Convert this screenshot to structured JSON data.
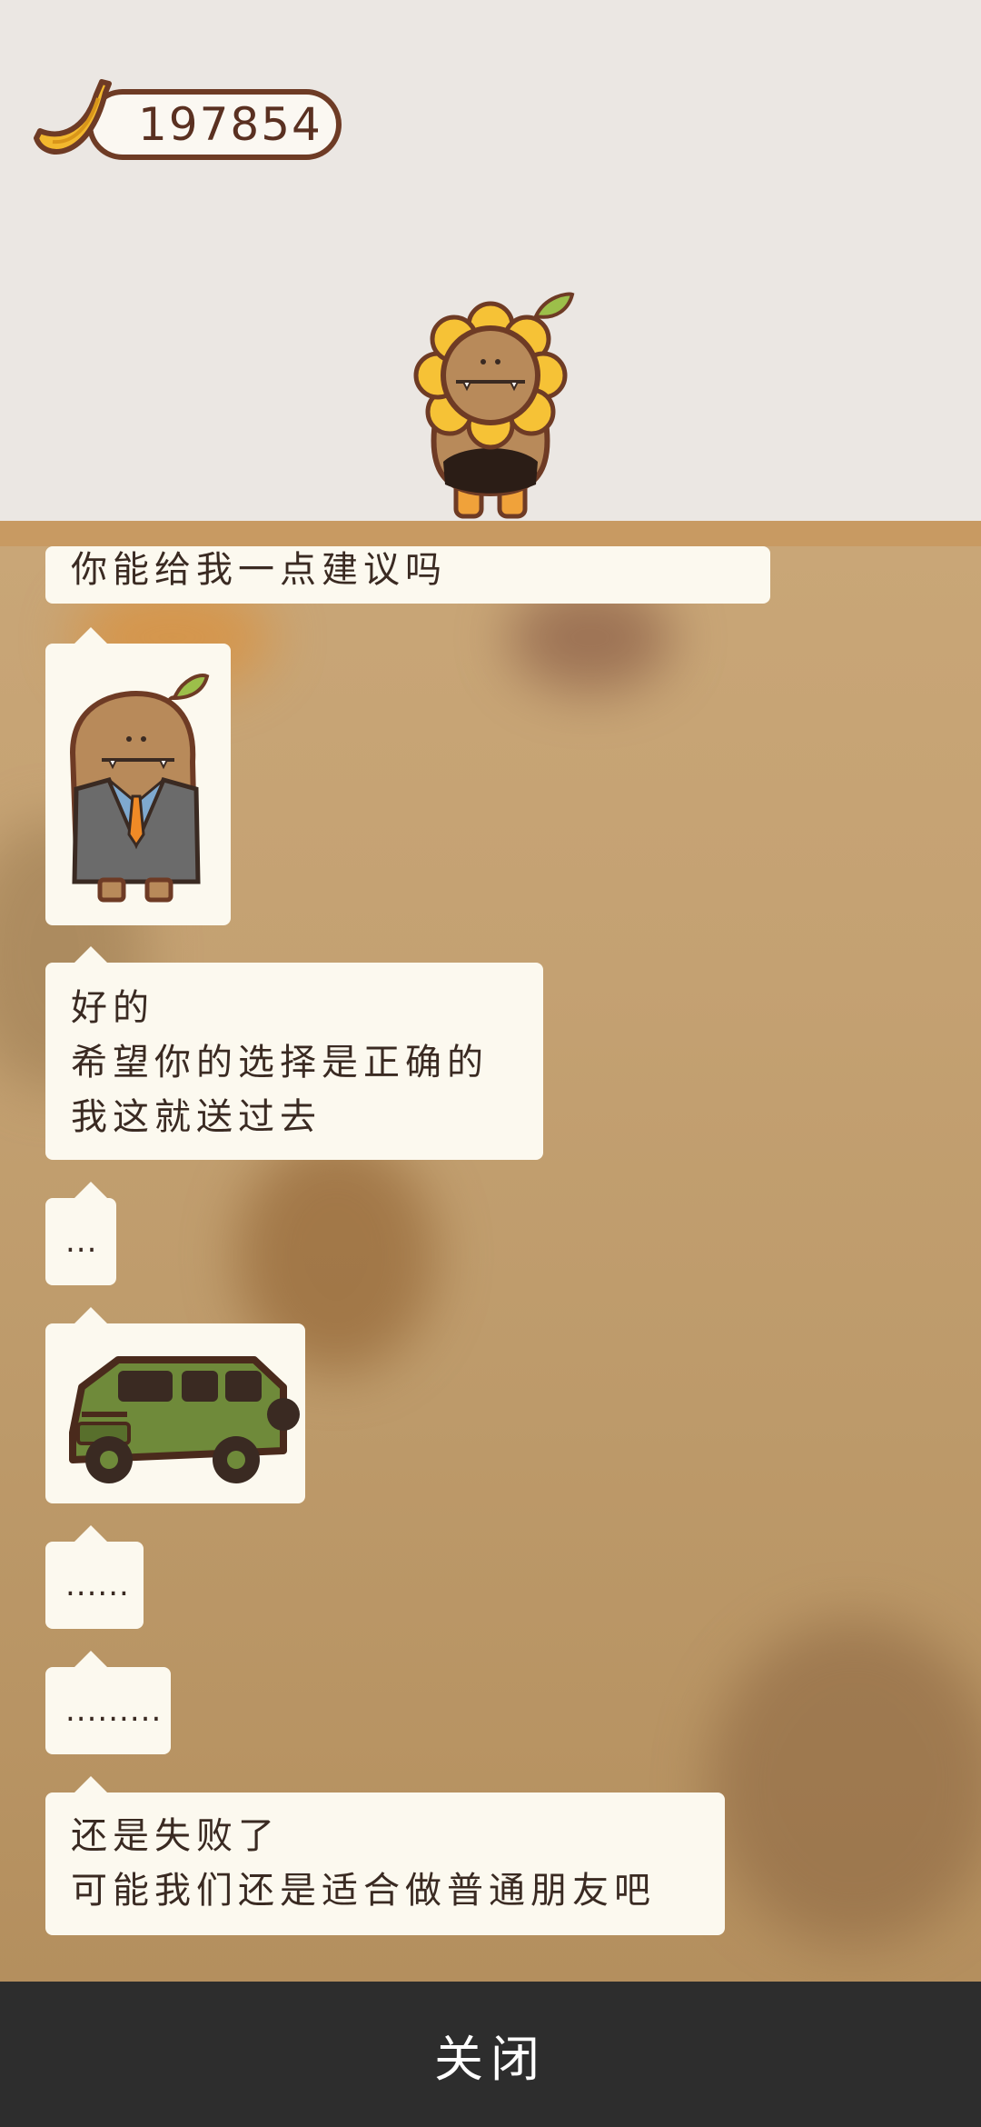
{
  "currency": {
    "icon": "banana-icon",
    "value": "197854"
  },
  "character_top": {
    "icon": "sunflower-character-icon"
  },
  "messages": [
    {
      "type": "text",
      "lines": [
        "你能给我一点建议吗"
      ]
    },
    {
      "type": "sticker",
      "icon": "suited-potato-character-sticker"
    },
    {
      "type": "text",
      "lines": [
        "好的",
        "希望你的选择是正确的",
        "我这就送过去"
      ]
    },
    {
      "type": "text",
      "lines": [
        "..."
      ]
    },
    {
      "type": "sticker",
      "icon": "green-jeep-sticker"
    },
    {
      "type": "text",
      "lines": [
        "......"
      ]
    },
    {
      "type": "text",
      "lines": [
        "........."
      ]
    },
    {
      "type": "text",
      "lines": [
        "还是失败了",
        "可能我们还是适合做普通朋友吧"
      ]
    }
  ],
  "footer": {
    "close_label": "关闭"
  },
  "colors": {
    "background": "#ebe7e3",
    "chat_background": "#c4a172",
    "bubble": "#fcf9ef",
    "footer": "#2d2d2d",
    "brown_outline": "#6e3b25"
  }
}
